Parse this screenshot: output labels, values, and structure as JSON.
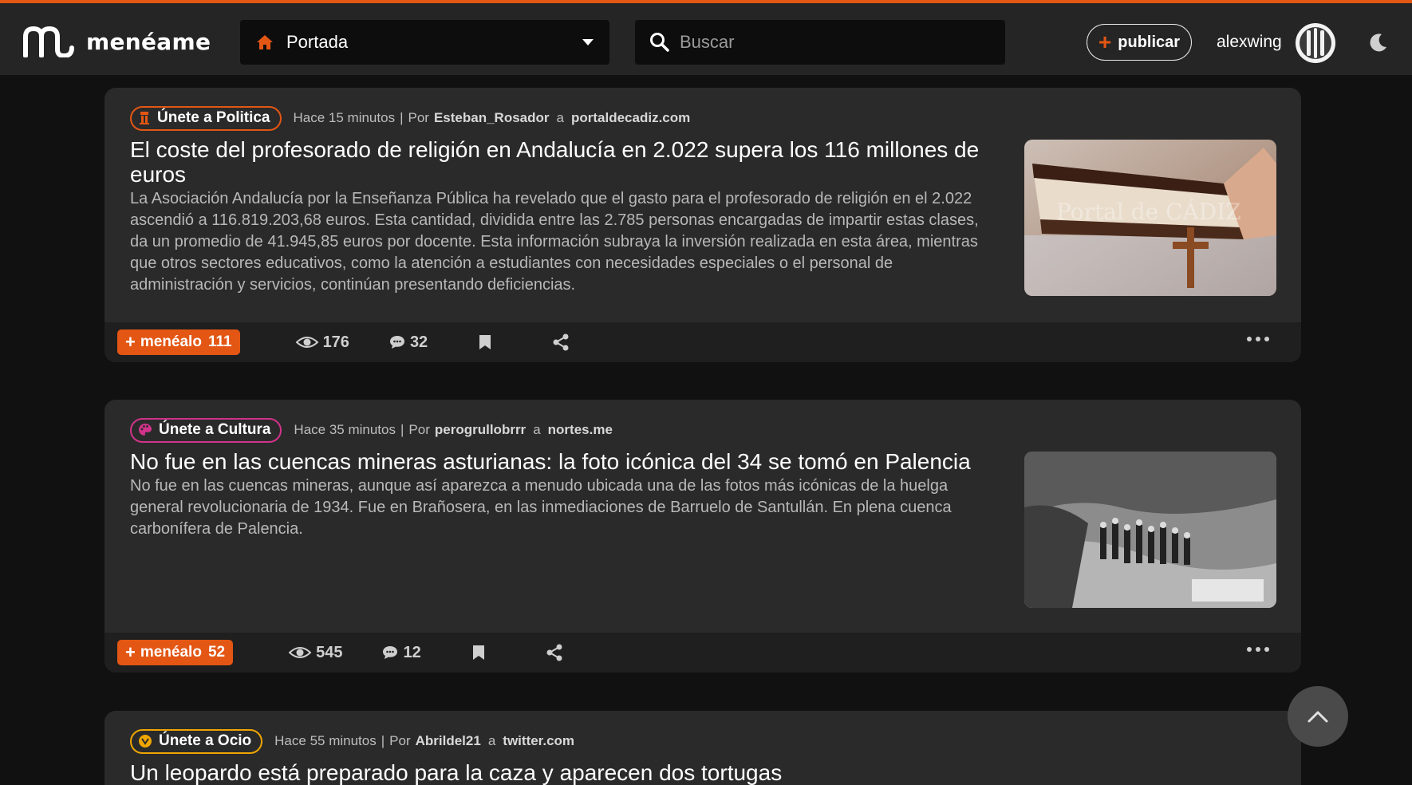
{
  "header": {
    "brand": "menéame",
    "section_select": {
      "label": "Portada"
    },
    "search": {
      "placeholder": "Buscar"
    },
    "publish_label": "publicar",
    "username": "alexwing"
  },
  "stories": [
    {
      "sub": {
        "label": "Únete a Politica",
        "color": "#e35614"
      },
      "time": "Hace 15 minutos",
      "by": "Por",
      "user": "Esteban_Rosador",
      "a": "a",
      "domain": "portaldecadiz.com",
      "title": "El coste del profesorado de religión en Andalucía en 2.022 supera los 116 millones de euros",
      "summary": "La Asociación Andalucía por la Enseñanza Pública ha revelado que el gasto para el profesorado de religión en el 2.022 ascendió a 116.819.203,68 euros. Esta cantidad, dividida entre las 2.785 personas encargadas de impartir estas clases, da un promedio de 41.945,85 euros por docente. Esta información subraya la inversión realizada en esta área, mientras que otros sectores educativos, como la atención a estudiantes con necesidades especiales o el personal de administración y servicios, continúan presentando deficiencias.",
      "thumb_watermark": "Portal de CÁDIZ",
      "menealo_label": "menéalo",
      "votes": "111",
      "views": "176",
      "comments": "32"
    },
    {
      "sub": {
        "label": "Únete a Cultura",
        "color": "#d1338a"
      },
      "time": "Hace 35 minutos",
      "by": "Por",
      "user": "perogrullobrrr",
      "a": "a",
      "domain": "nortes.me",
      "title": "No fue en las cuencas mineras asturianas: la foto icónica del 34 se tomó en Palencia",
      "summary": "No fue en las cuencas mineras, aunque así aparezca a menudo ubicada una de las fotos más icónicas de la huelga general revolucionaria de 1934. Fue en Brañosera, en las inmediaciones de Barruelo de Santullán. En plena cuenca carbonífera de Palencia.",
      "menealo_label": "menéalo",
      "votes": "52",
      "views": "545",
      "comments": "12"
    },
    {
      "sub": {
        "label": "Únete a Ocio",
        "color": "#f0a500"
      },
      "time": "Hace 55 minutos",
      "by": "Por",
      "user": "Abrildel21",
      "a": "a",
      "domain": "twitter.com",
      "title": "Un leopardo está preparado para la caza y aparecen dos tortugas"
    }
  ],
  "icons": {
    "home": "home-icon",
    "search": "search-icon",
    "views": "eye-icon",
    "comments": "comment-icon",
    "bookmark": "bookmark-icon",
    "share": "share-icon",
    "more": "more-dots-icon",
    "theme": "moon-icon",
    "scroll": "chevron-up-icon"
  },
  "colors": {
    "accent": "#e35614",
    "background": "#111111",
    "card": "#2a2a2a",
    "topbar": "#252525"
  }
}
